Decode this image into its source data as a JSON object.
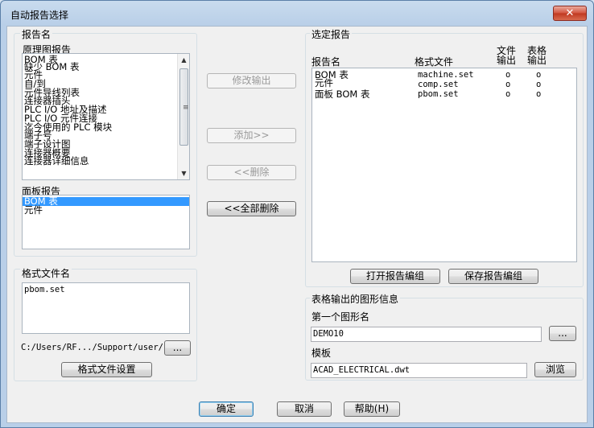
{
  "window": {
    "title": "自动报告选择",
    "close_symbol": "✕"
  },
  "report_name_group": {
    "label": "报告名",
    "schematic_label": "原理图报告",
    "schematic_items": [
      "BOM 表",
      "缺少 BOM 表",
      "元件",
      "自/到",
      "元件导线列表",
      "连接器插头",
      "PLC I/O 地址及描述",
      "PLC I/O 元件连接",
      "迄今使用的 PLC 模块",
      "端子号",
      "端子设计图",
      "连接器概要",
      "连接器详细信息"
    ],
    "panel_label": "面板报告",
    "panel_items": [
      "BOM 表",
      "元件"
    ],
    "panel_selected_index": 0
  },
  "format_file_group": {
    "label": "格式文件名",
    "file_value": "pbom.set",
    "path": "C:/Users/RF.../Support/user/",
    "browse_label": "...",
    "settings_button": "格式文件设置"
  },
  "middle_buttons": {
    "modify_output": "修改输出",
    "add": "添加>>",
    "remove": "<<删除",
    "remove_all": "<<全部删除"
  },
  "selected_reports_group": {
    "label": "选定报告",
    "columns": {
      "report_name": "报告名",
      "format_file": "格式文件",
      "file_output_1": "文件",
      "file_output_2": "输出",
      "table_output_1": "表格",
      "table_output_2": "输出"
    },
    "rows": [
      {
        "name_line1": "BOM 表",
        "name_line2": "元件",
        "format": "machine.set",
        "file": "o",
        "table": "o"
      },
      {
        "name_line1": "",
        "name_line2": "",
        "format": "comp.set",
        "file": "o",
        "table": "o"
      },
      {
        "name_line1": "面板 BOM 表",
        "name_line2": "",
        "format": "pbom.set",
        "file": "o",
        "table": "o"
      }
    ],
    "open_button": "打开报告编组",
    "save_button": "保存报告编组"
  },
  "table_graphic_group": {
    "label": "表格输出的图形信息",
    "first_graphic_label": "第一个图形名",
    "first_graphic_value": "DEMO10",
    "browse_label": "...",
    "template_label": "模板",
    "template_value": "ACAD_ELECTRICAL.dwt",
    "template_browse": "浏览"
  },
  "footer": {
    "ok": "确定",
    "cancel": "取消",
    "help": "帮助(H)"
  }
}
